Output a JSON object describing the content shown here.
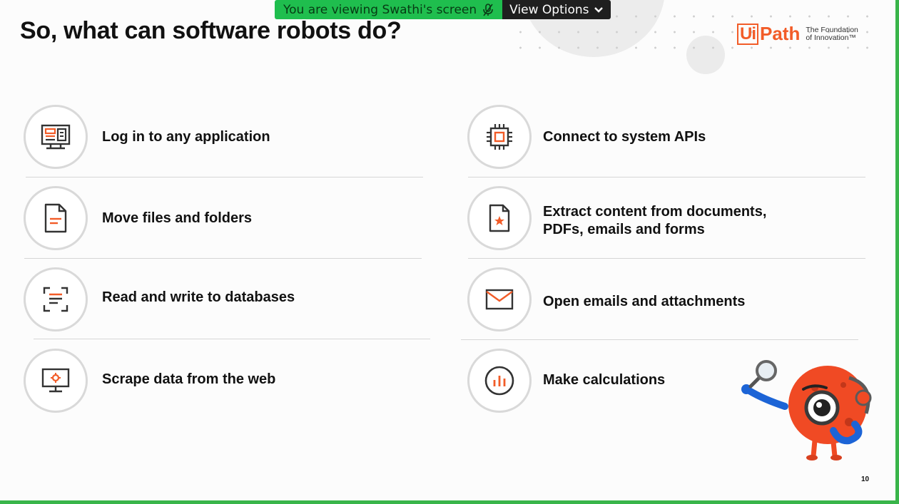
{
  "share_banner": {
    "viewing_text": "You are viewing Swathi's screen",
    "view_options_label": "View Options"
  },
  "slide": {
    "title": "So, what can software robots do?",
    "page_number": "10"
  },
  "logo": {
    "ui": "Ui",
    "path": "Path",
    "tagline_line1": "The Foundation",
    "tagline_line2": "of Innovation™"
  },
  "items": {
    "login": "Log in to any application",
    "files": "Move files and folders",
    "databases": "Read and write to databases",
    "scrape": "Scrape data from the web",
    "apis": "Connect to system APIs",
    "extract_line1": "Extract content from documents,",
    "extract_line2": "PDFs, emails and forms",
    "emails": "Open emails and attachments",
    "calculations": "Make calculations"
  },
  "colors": {
    "accent_orange": "#f25c28",
    "icon_dark": "#333333",
    "share_green": "#1fbe4e",
    "border_green": "#39b54a"
  },
  "icons": [
    "application-window-icon",
    "document-icon",
    "database-scan-icon",
    "monitor-gear-icon",
    "chip-icon",
    "document-star-icon",
    "envelope-icon",
    "bar-chart-icon",
    "microphone-muted-icon",
    "chevron-down-icon"
  ]
}
